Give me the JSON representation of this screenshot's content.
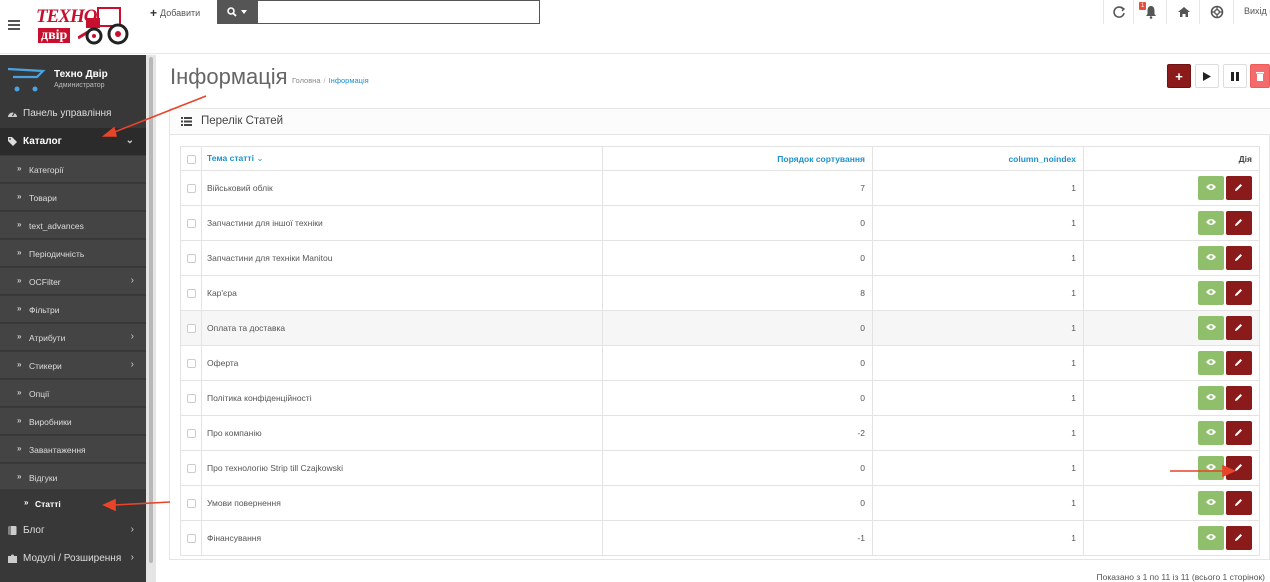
{
  "header": {
    "logo_line1": "ТЕХНО",
    "logo_line2": "двір",
    "add_label": "Добавити",
    "search_placeholder": "",
    "notifications_count": "1",
    "logout_label": "Вихід ("
  },
  "sidebar": {
    "profile_name": "Техно Двір",
    "profile_role": "Администратор",
    "items": [
      {
        "label": "Панель управління",
        "icon": "dashboard-icon"
      },
      {
        "label": "Каталог",
        "icon": "tags-icon"
      }
    ],
    "catalog_sub": [
      {
        "label": "Категорії"
      },
      {
        "label": "Товари"
      },
      {
        "label": "text_advances"
      },
      {
        "label": "Періодичність"
      },
      {
        "label": "OCFilter"
      },
      {
        "label": "Фільтри"
      },
      {
        "label": "Атрибути"
      },
      {
        "label": "Стикери"
      },
      {
        "label": "Опції"
      },
      {
        "label": "Виробники"
      },
      {
        "label": "Завантаження"
      },
      {
        "label": "Відгуки"
      },
      {
        "label": "Статті"
      }
    ],
    "blog_label": "Блог",
    "modules_label": "Модулі / Розширення"
  },
  "page": {
    "title": "Інформація",
    "breadcrumb_home": "Головна",
    "breadcrumb_sep": "/",
    "breadcrumb_current": "Інформація",
    "panel_title": "Перелік Статей"
  },
  "table": {
    "headers": {
      "name": "Тема статті",
      "sort": "Порядок сортування",
      "noindex": "column_noindex",
      "action": "Дія"
    },
    "rows": [
      {
        "name": "Військовий облік",
        "sort": "7",
        "noindex": "1"
      },
      {
        "name": "Запчастини для іншої техніки",
        "sort": "0",
        "noindex": "1"
      },
      {
        "name": "Запчастини для техніки Manitou",
        "sort": "0",
        "noindex": "1"
      },
      {
        "name": "Кар'єра",
        "sort": "8",
        "noindex": "1"
      },
      {
        "name": "Оплата та доставка",
        "sort": "0",
        "noindex": "1"
      },
      {
        "name": "Оферта",
        "sort": "0",
        "noindex": "1"
      },
      {
        "name": "Політика конфіденційності",
        "sort": "0",
        "noindex": "1"
      },
      {
        "name": "Про компанію",
        "sort": "-2",
        "noindex": "1"
      },
      {
        "name": "Про технологію Strip till Czajkowski",
        "sort": "0",
        "noindex": "1"
      },
      {
        "name": "Умови повернення",
        "sort": "0",
        "noindex": "1"
      },
      {
        "name": "Фінансування",
        "sort": "-1",
        "noindex": "1"
      }
    ]
  },
  "pagination_text": "Показано з 1 по 11 із 11 (всього 1 сторінок)",
  "colors": {
    "sidebar_bg": "#383838",
    "primary_dark_red": "#8b1a1a",
    "view_green": "#8fbf6a",
    "link_blue": "#1e91cf",
    "annotation_arrow": "#e8442a"
  }
}
